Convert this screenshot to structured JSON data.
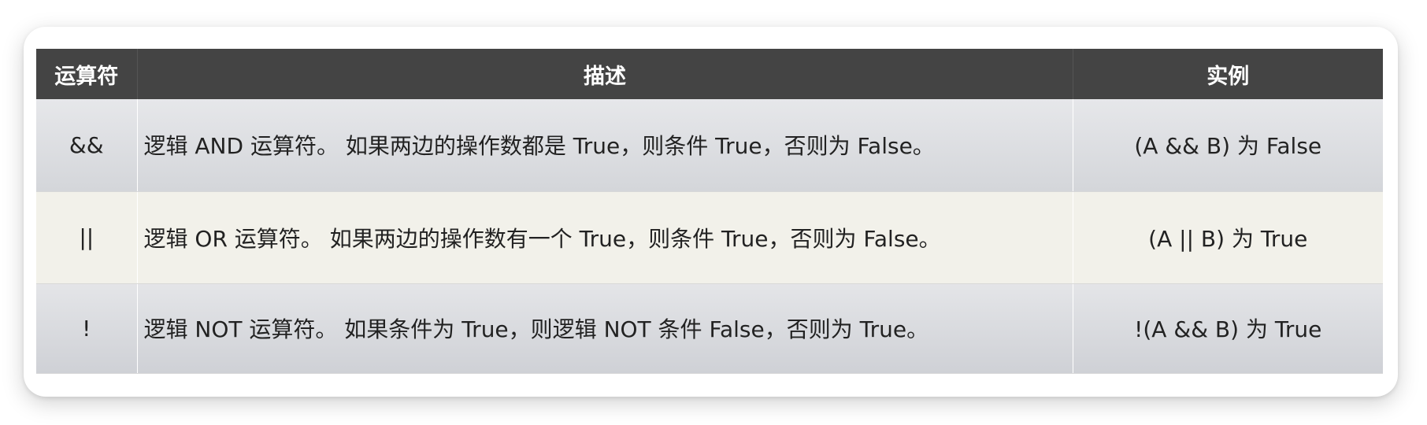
{
  "table": {
    "headers": [
      "运算符",
      "描述",
      "实例"
    ],
    "rows": [
      {
        "operator": "&&",
        "description": "逻辑 AND 运算符。 如果两边的操作数都是 True，则条件 True，否则为 False。",
        "example": "(A && B) 为 False"
      },
      {
        "operator": "||",
        "description": "逻辑 OR 运算符。 如果两边的操作数有一个 True，则条件 True，否则为 False。",
        "example": "(A || B) 为 True"
      },
      {
        "operator": "!",
        "description": "逻辑 NOT 运算符。 如果条件为 True，则逻辑 NOT 条件 False，否则为 True。",
        "example": "!(A && B) 为 True"
      }
    ]
  },
  "colors": {
    "header_bg": "#444444",
    "header_text": "#ffffff",
    "row_odd_bg": "#dcdde1",
    "row_even_bg": "#f2f1ea"
  }
}
